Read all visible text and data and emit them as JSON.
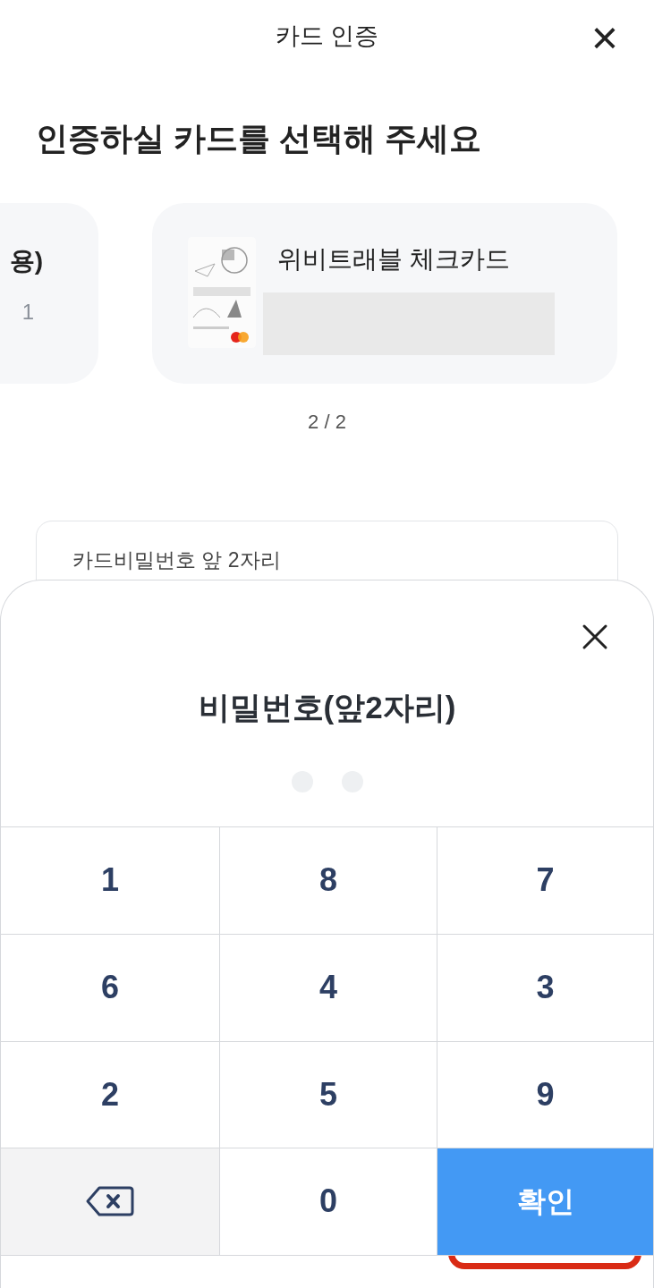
{
  "header": {
    "title": "카드 인증",
    "close": "×"
  },
  "heading": "인증하실 카드를 선택해 주세요",
  "cards": [
    {
      "kind": "text",
      "title": "용)",
      "subtitle": "1"
    },
    {
      "title": "위비트래블 체크카드"
    }
  ],
  "page_indicator": "2 / 2",
  "password_field": {
    "label": "카드비밀번호 앞 2자리"
  },
  "sheet": {
    "title": "비밀번호(앞2자리)",
    "pin_dots": [
      {
        "filled": false
      },
      {
        "filled": false
      }
    ],
    "keys": [
      {
        "kind": "digit",
        "label": "1"
      },
      {
        "kind": "digit",
        "label": "8"
      },
      {
        "kind": "digit",
        "label": "7"
      },
      {
        "kind": "digit",
        "label": "6"
      },
      {
        "kind": "digit",
        "label": "4"
      },
      {
        "kind": "digit",
        "label": "3"
      },
      {
        "kind": "digit",
        "label": "2"
      },
      {
        "kind": "digit",
        "label": "5"
      },
      {
        "kind": "digit",
        "label": "9"
      },
      {
        "kind": "backspace"
      },
      {
        "kind": "digit",
        "label": "0"
      },
      {
        "kind": "confirm",
        "label": "확인",
        "highlighted": true
      }
    ]
  }
}
